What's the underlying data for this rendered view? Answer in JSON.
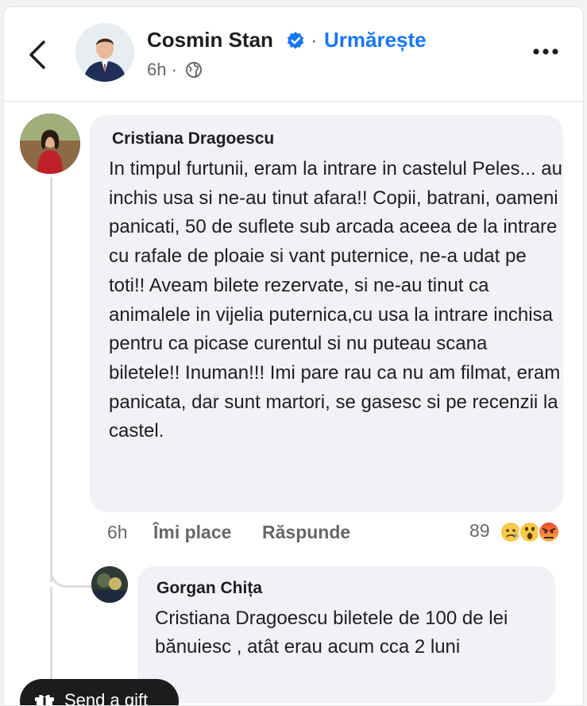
{
  "post": {
    "author": "Cosmin Stan",
    "follow_label": "Urmărește",
    "separator": "·",
    "time": "6h ·",
    "icons": {
      "back": "chevron-left-icon",
      "verified": "verified-badge-icon",
      "audience": "globe-icon",
      "more": "more-icon"
    },
    "colors": {
      "link": "#1877f2",
      "verified": "#1877f2",
      "muted": "#65676b"
    }
  },
  "comments": [
    {
      "author": "Cristiana Dragoescu",
      "text": "In timpul furtunii, eram la intrare in castelul Peles... au inchis usa si ne-au tinut afara!! Copii, batrani, oameni panicati, 50 de suflete sub arcada aceea de la intrare cu rafale de ploaie si vant puternice, ne-a udat pe toti!! Aveam bilete rezervate, si ne-au tinut ca animalele in vijelia puternica,cu usa la intrare inchisa pentru ca picase curentul si nu puteau scana biletele!! Inuman!!! Imi pare rau ca nu am filmat, eram panicata, dar sunt martori, se gasesc si pe recenzii la castel.",
      "time": "6h",
      "like_label": "Îmi place",
      "reply_label": "Răspunde",
      "reaction_count": "89",
      "reactions": [
        "sad-reaction-icon",
        "wow-reaction-icon",
        "angry-reaction-icon"
      ]
    },
    {
      "author": "Gorgan Chița",
      "text": "Cristiana Dragoescu  biletele de 100 de lei bănuiesc , atât erau acum cca 2 luni"
    }
  ],
  "gift_button": {
    "label": "Send a gift",
    "icon": "gift-icon"
  }
}
